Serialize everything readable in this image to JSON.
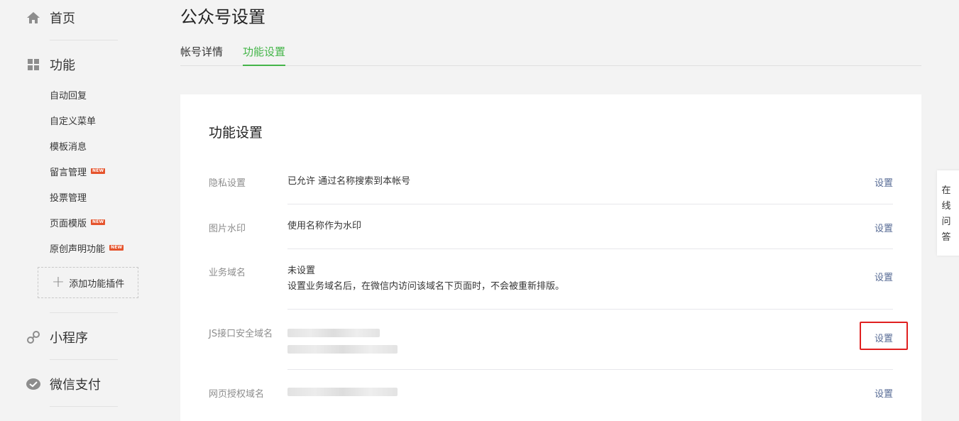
{
  "sidebar": {
    "home": "首页",
    "features": "功能",
    "sub_items": [
      "自动回复",
      "自定义菜单",
      "模板消息",
      "留言管理",
      "投票管理",
      "页面模版",
      "原创声明功能"
    ],
    "new_badge": "NEW",
    "add_plugin": "添加功能插件",
    "mini_program": "小程序",
    "wechat_pay": "微信支付"
  },
  "header": {
    "title": "公众号设置",
    "tabs": [
      "帐号详情",
      "功能设置"
    ],
    "active_tab": "功能设置"
  },
  "card": {
    "title": "功能设置",
    "rows": [
      {
        "label": "隐私设置",
        "value": "已允许 通过名称搜索到本帐号",
        "action": "设置"
      },
      {
        "label": "图片水印",
        "value": "使用名称作为水印",
        "action": "设置"
      },
      {
        "label": "业务域名",
        "value": "未设置",
        "desc": "设置业务域名后，在微信内访问该域名下页面时，不会被重新排版。",
        "action": "设置"
      },
      {
        "label": "JS接口安全域名",
        "value": "",
        "action": "设置"
      },
      {
        "label": "网页授权域名",
        "value": "",
        "action": "设置"
      }
    ]
  },
  "float_help": [
    "在",
    "线",
    "问",
    "答"
  ],
  "colors": {
    "accent": "#44b549",
    "link": "#576b95",
    "highlight": "#e02020",
    "badge": "#e5532c"
  }
}
